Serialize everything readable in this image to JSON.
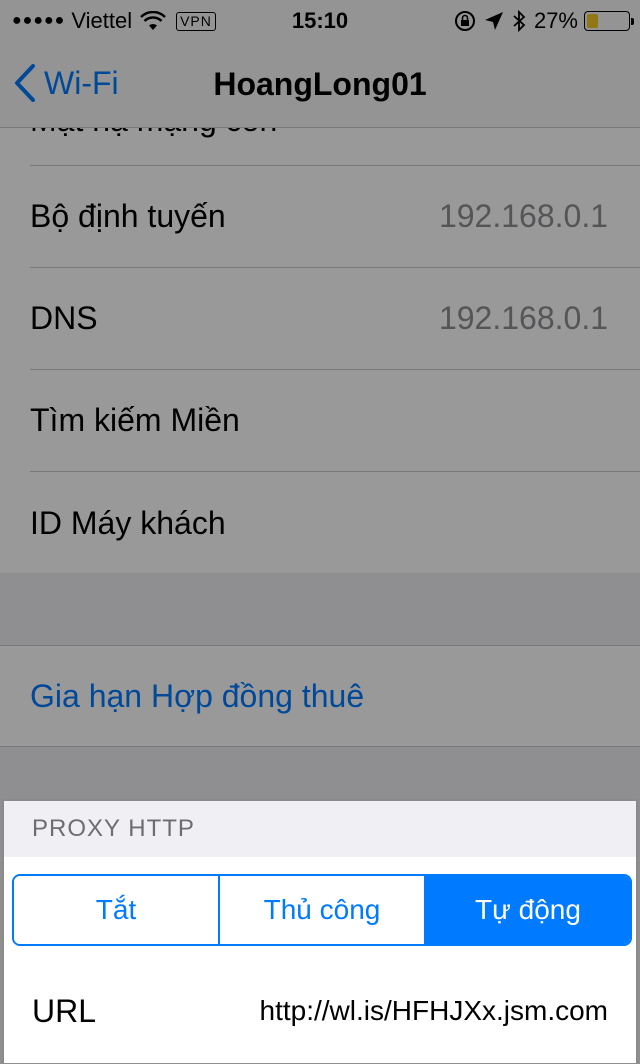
{
  "status_bar": {
    "signal": "●●●●●",
    "carrier": "Viettel",
    "vpn": "VPN",
    "time": "15:10",
    "battery_pct": "27%",
    "battery_level": 0.27
  },
  "nav": {
    "back_label": "Wi-Fi",
    "title": "HoangLong01"
  },
  "list": {
    "rows": [
      {
        "label": "Bộ định tuyến",
        "value": "192.168.0.1"
      },
      {
        "label": "DNS",
        "value": "192.168.0.1"
      },
      {
        "label": "Tìm kiếm Miền",
        "value": ""
      },
      {
        "label": "ID Máy khách",
        "value": ""
      }
    ],
    "cut_row_label": "Mặt nạ mạng con"
  },
  "renew_lease": "Gia hạn Hợp đồng thuê",
  "proxy": {
    "header": "PROXY HTTP",
    "segments": [
      "Tắt",
      "Thủ công",
      "Tự động"
    ],
    "selected": "Tự động",
    "url_label": "URL",
    "url_value": "http://wl.is/HFHJXx.jsm.com"
  },
  "colors": {
    "accent": "#007aff",
    "battery_fill": "#f3c623"
  }
}
